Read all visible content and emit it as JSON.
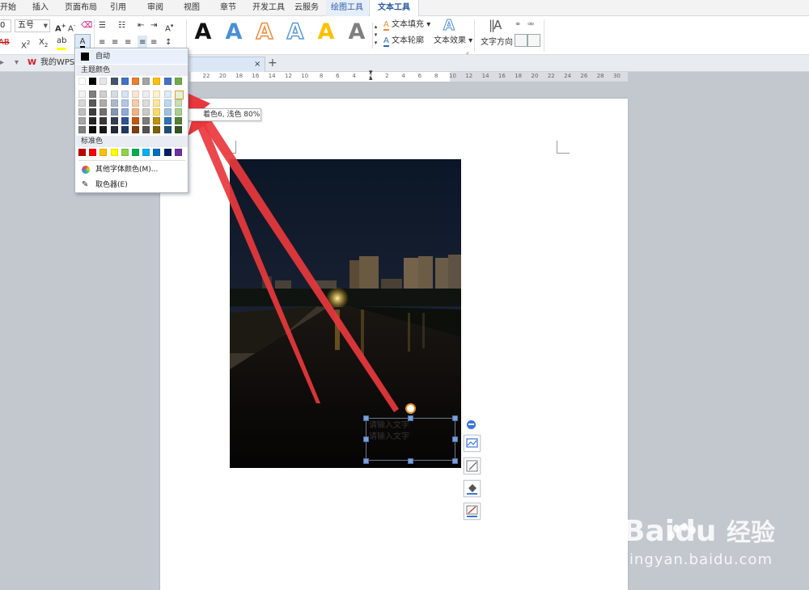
{
  "menu": {
    "tabs": [
      "开始",
      "插入",
      "页面布局",
      "引用",
      "审阅",
      "视图",
      "章节",
      "开发工具",
      "云服务",
      "绘图工具",
      "文本工具"
    ],
    "active_tab": "文本工具"
  },
  "ribbon": {
    "font_size": "五号",
    "font_name": "0",
    "text_fill": "文本填充",
    "text_outline": "文本轮廓",
    "text_effect": "文本效果",
    "text_direction": "文字方向",
    "style_letter": "A",
    "colors": {
      "style_black": "#111111",
      "style_blue": "#4a8fd6",
      "style_orange": "#f08a35",
      "style_blue_outline": "#5b9bd5",
      "style_yellow": "#ffc000",
      "style_gray": "#7f7f7f"
    }
  },
  "tabbar": {
    "my_wps": "我的WPS",
    "close": "×",
    "add": "+"
  },
  "ruler": {
    "ticks": [
      "22",
      "20",
      "18",
      "16",
      "14",
      "12",
      "10",
      "8",
      "6",
      "4",
      "2",
      "2",
      "4",
      "6",
      "8",
      "10",
      "12",
      "14",
      "16",
      "18",
      "20",
      "22",
      "24",
      "26",
      "28",
      "30"
    ]
  },
  "dropdown": {
    "auto": "自动",
    "theme_header": "主题颜色",
    "standard_header": "标准色",
    "more_colors": "其他字体颜色(M)...",
    "eyedropper": "取色器(E)",
    "theme_top": [
      "#ffffff",
      "#000000",
      "#e7e6e6",
      "#44546a",
      "#4472c4",
      "#ed7d31",
      "#a5a5a5",
      "#ffc000",
      "#4472c4",
      "#70ad47"
    ],
    "theme_shades": [
      [
        "#f2f2f2",
        "#7f7f7f",
        "#d0cece",
        "#d6dce4",
        "#d9e2f3",
        "#fbe5d5",
        "#ededed",
        "#fff2cc",
        "#deebf6",
        "#e2efd9"
      ],
      [
        "#d8d8d8",
        "#595959",
        "#aeabab",
        "#adb9ca",
        "#b4c6e7",
        "#f7cbac",
        "#dbdbdb",
        "#fee599",
        "#bdd7ee",
        "#c5e0b3"
      ],
      [
        "#bfbfbf",
        "#3f3f3f",
        "#757070",
        "#8496b0",
        "#8eaadb",
        "#f4b183",
        "#c9c9c9",
        "#ffd965",
        "#9cc3e5",
        "#a8d08d"
      ],
      [
        "#a5a5a5",
        "#262626",
        "#3a3838",
        "#323f4f",
        "#2f5496",
        "#c45911",
        "#7b7b7b",
        "#bf9000",
        "#2e75b5",
        "#538135"
      ],
      [
        "#7f7f7f",
        "#0c0c0c",
        "#171616",
        "#222a35",
        "#1f3864",
        "#833c0b",
        "#525252",
        "#7f6000",
        "#1e4e79",
        "#375623"
      ]
    ],
    "standard": [
      "#c00000",
      "#ff0000",
      "#ffc000",
      "#ffff00",
      "#92d050",
      "#00b050",
      "#00b0f0",
      "#0070c0",
      "#002060",
      "#7030a0"
    ]
  },
  "tooltip": {
    "text": "着色6, 浅色 80%"
  },
  "textbox": {
    "line1": "请输入文字",
    "line2": "请输入文字"
  },
  "watermark": {
    "brand": "Bai",
    "brand_suffix": "du",
    "cn": "经验",
    "url": "jingyan.baidu.com"
  }
}
